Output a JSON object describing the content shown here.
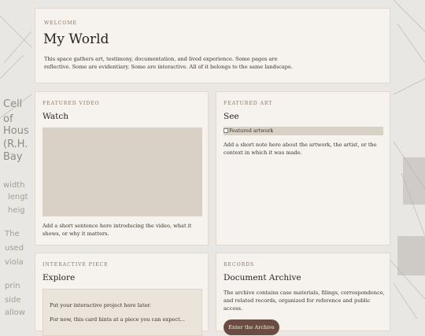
{
  "colors": {
    "page_background": "#e9e7e3",
    "card_background": "#f6f3ee",
    "accent": "#8b7668",
    "placeholder": "#d9d1c6",
    "button": "#6b4c43"
  },
  "background": {
    "sketch_text": [
      "Cell",
      "of",
      "Hous",
      "(R.H.",
      "Bay",
      "width",
      "lengt",
      "heig",
      "The",
      "used",
      "viola",
      "prin",
      "side",
      "allow"
    ]
  },
  "welcome": {
    "eyebrow": "WELCOME",
    "title": "My World",
    "body": "This space gathers art, testimony, documentation, and lived experience. Some pages are reflective. Some are evidentiary. Some are interactive. All of it belongs to the same landscape."
  },
  "video": {
    "eyebrow": "FEATURED VIDEO",
    "title": "Watch",
    "caption": "Add a short sentence here introducing the video, what it shows, or why it matters."
  },
  "art": {
    "eyebrow": "FEATURED ART",
    "title": "See",
    "image_alt": "Featured artwork",
    "note": "Add a short note here about the artwork, the artist, or the context in which it was made."
  },
  "interactive": {
    "eyebrow": "INTERACTIVE PIECE",
    "title": "Explore",
    "placeholder_text": "Put your interactive project here later.",
    "partial_text": "For now, this card hints at a piece you can expect..."
  },
  "records": {
    "eyebrow": "RECORDS",
    "title": "Document Archive",
    "body": "The archive contains case materials, filings, correspondence, and related records, organized for reference and public access.",
    "button_label": "Enter the Archive"
  }
}
